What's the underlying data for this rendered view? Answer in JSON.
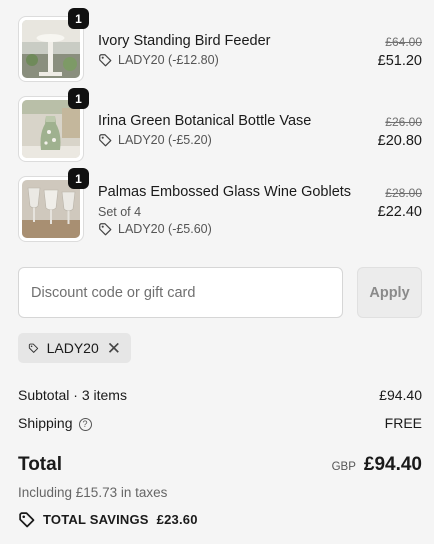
{
  "items": [
    {
      "quantity": "1",
      "title": "Ivory Standing Bird Feeder",
      "variant": "",
      "discount_label": "LADY20 (-£12.80)",
      "original_price": "£64.00",
      "final_price": "£51.20"
    },
    {
      "quantity": "1",
      "title": "Irina Green Botanical Bottle Vase",
      "variant": "",
      "discount_label": "LADY20 (-£5.20)",
      "original_price": "£26.00",
      "final_price": "£20.80"
    },
    {
      "quantity": "1",
      "title": "Palmas Embossed Glass Wine Goblets",
      "variant": "Set of 4",
      "discount_label": "LADY20 (-£5.60)",
      "original_price": "£28.00",
      "final_price": "£22.40"
    }
  ],
  "discount": {
    "placeholder": "Discount code or gift card",
    "value": "",
    "apply_label": "Apply",
    "applied_code": "LADY20",
    "remove_glyph": "✕"
  },
  "summary": {
    "subtotal_label": "Subtotal · 3 items",
    "subtotal_value": "£94.40",
    "shipping_label": "Shipping",
    "shipping_help_glyph": "?",
    "shipping_value": "FREE",
    "total_label": "Total",
    "currency": "GBP",
    "total_value": "£94.40",
    "taxes_note": "Including £15.73 in taxes",
    "savings_label": "TOTAL SAVINGS",
    "savings_value": "£23.60"
  },
  "colors": {
    "background": "#f5f5f5",
    "badge": "#111111",
    "chip": "#e6e6e6",
    "muted_text": "#707070"
  },
  "icons": {
    "discount_tag": "tag-icon",
    "remove_code": "close-icon",
    "shipping_help": "question-circle-icon",
    "savings": "tag-icon"
  }
}
